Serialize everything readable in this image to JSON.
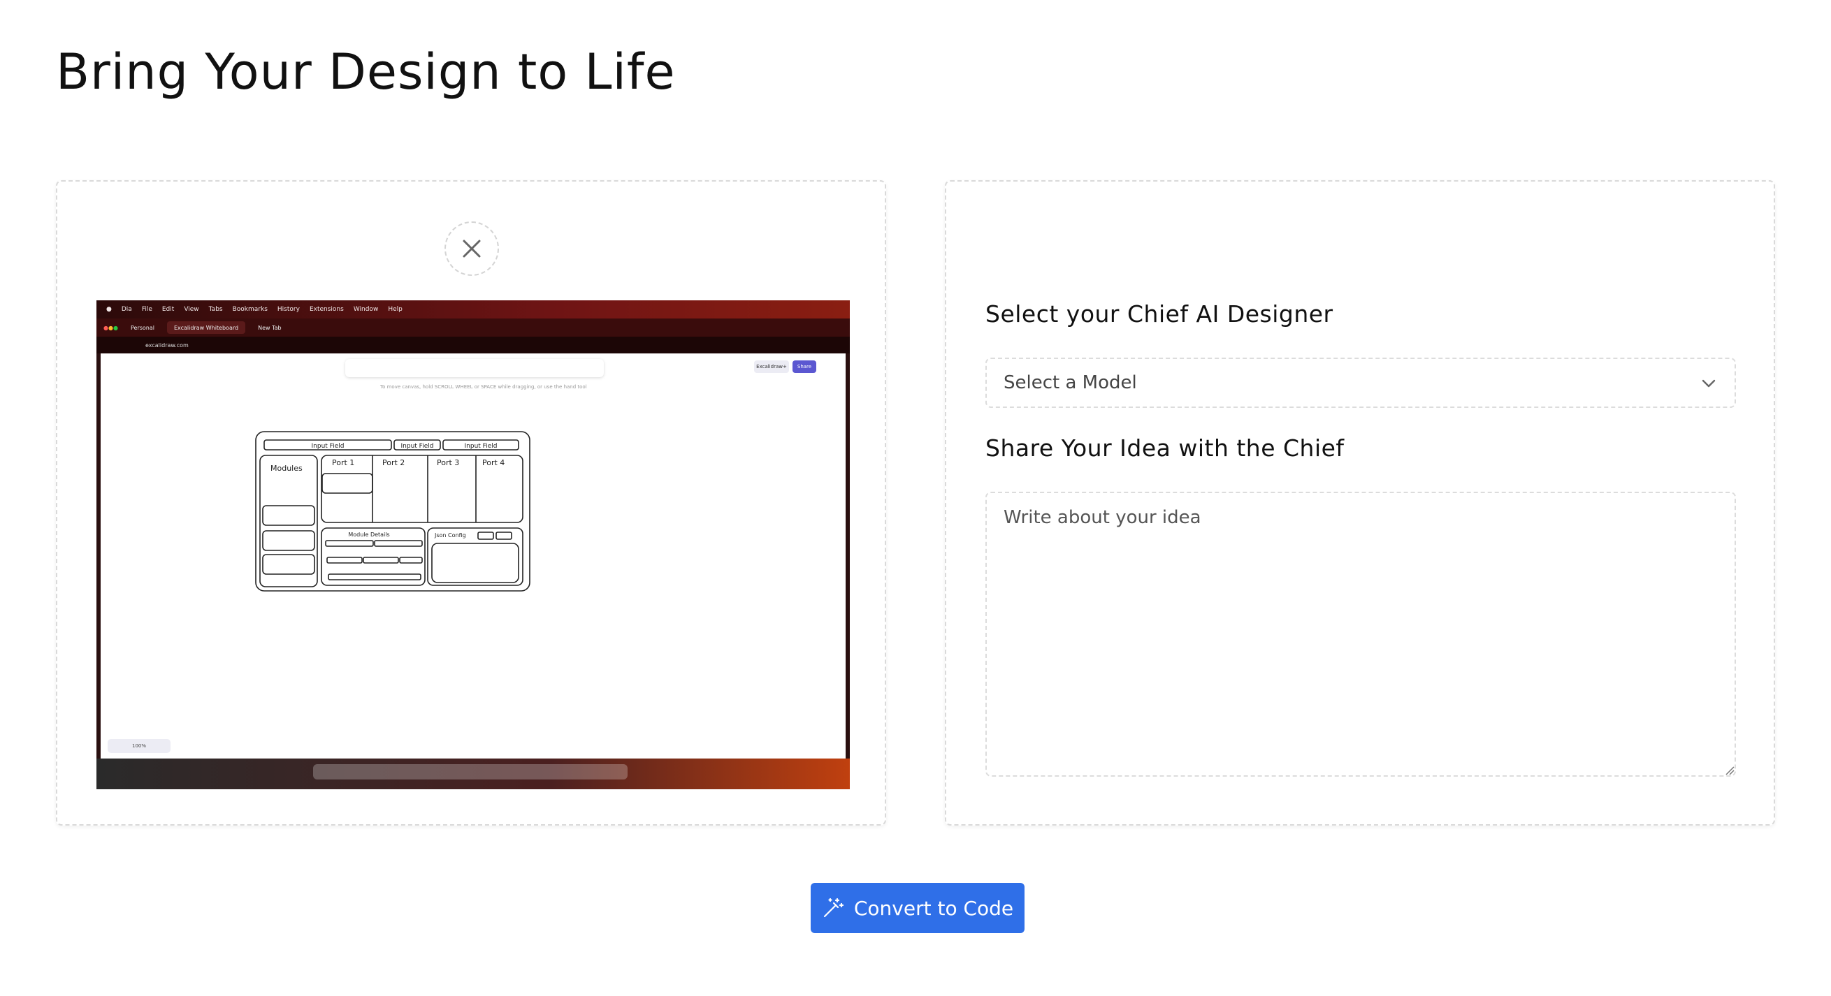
{
  "header": {
    "title": "Bring Your Design to Life"
  },
  "upload_panel": {
    "close_icon": "close-icon",
    "preview": {
      "menubar": [
        "Dia",
        "File",
        "Edit",
        "View",
        "Tabs",
        "Bookmarks",
        "History",
        "Extensions",
        "Window",
        "Help"
      ],
      "tabs": [
        "Personal",
        "Excalidraw Whiteboard",
        "New Tab"
      ],
      "url": "excalidraw.com",
      "share_label": "Share",
      "library_label": "Excalidraw+",
      "zoom": "100%",
      "hint": "To move canvas, hold SCROLL WHEEL or SPACE while dragging, or use the hand tool",
      "sketch": {
        "input_fields": [
          "Input Field",
          "Input Field",
          "Input Field"
        ],
        "modules_label": "Modules",
        "ports": [
          "Port 1",
          "Port 2",
          "Port 3",
          "Port 4"
        ],
        "module_details_label": "Module Details",
        "json_config_label": "Json Config"
      }
    }
  },
  "form_panel": {
    "model_label": "Select your Chief AI Designer",
    "model_select": {
      "value": "Select a Model",
      "icon": "chevron-down-icon"
    },
    "idea_label": "Share Your Idea with the Chief",
    "idea_input": {
      "placeholder": "Write about your idea",
      "value": ""
    }
  },
  "convert_button": {
    "label": "Convert to Code",
    "icon": "magic-wand-icon"
  },
  "colors": {
    "accent": "#2f6fe8",
    "border": "#dcdcdc"
  }
}
